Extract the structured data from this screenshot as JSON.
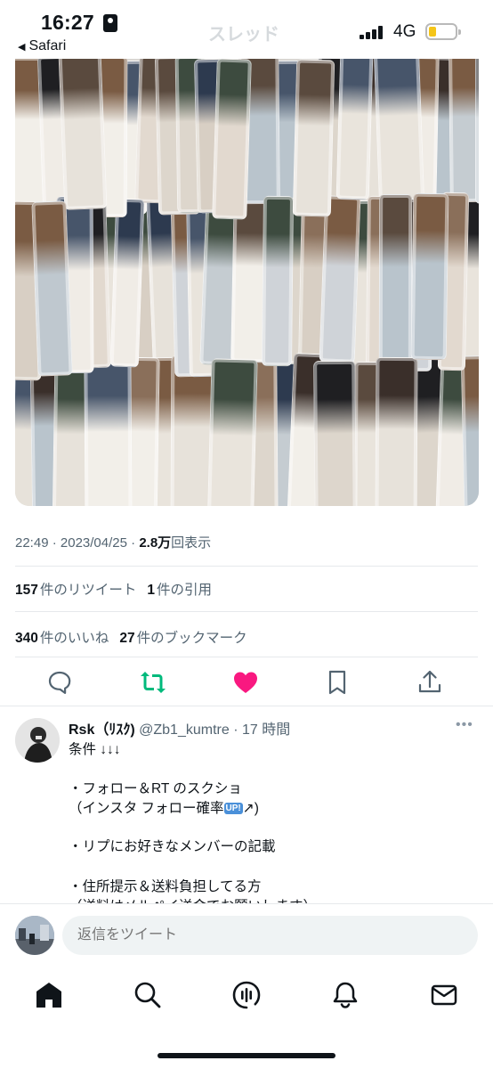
{
  "status_bar": {
    "time": "16:27",
    "back_app": "Safari",
    "faded_title": "スレッド",
    "network": "4G",
    "battery_color": "#f5c518"
  },
  "photo": {
    "icon": "photo-collage"
  },
  "tweet_meta": {
    "time": "22:49",
    "sep1": " · ",
    "date": "2023/04/25",
    "sep2": " · ",
    "views": "2.8万",
    "views_label": "回表示"
  },
  "stats": {
    "retweets_count": "157",
    "retweets_label": "件のリツイート",
    "quotes_count": "1",
    "quotes_label": "件の引用",
    "likes_count": "340",
    "likes_label": "件のいいね",
    "bookmarks_count": "27",
    "bookmarks_label": "件のブックマーク"
  },
  "actions": {
    "reply_icon": "reply-icon",
    "retweet_icon": "retweet-icon",
    "retweet_color": "#00ba7c",
    "like_icon": "like-icon",
    "like_color": "#f91880",
    "bookmark_icon": "bookmark-icon",
    "share_icon": "share-icon"
  },
  "reply": {
    "name": "Rsk（ﾘｽｸ)",
    "handle": "@Zb1_kumtre",
    "time": "· 17 時間",
    "more": "•••",
    "lines": [
      "条件 ↓↓↓",
      "・フォロー＆RT のスクショ",
      "（インスタ フォロー確率",
      "・リプにお好きなメンバーの記載",
      "・住所提示＆送料負担してる方",
      "（送料はメルペイ送金でお願いします）"
    ],
    "up_badge": "UP!",
    "line2_suffix": "↗)"
  },
  "composer": {
    "placeholder": "返信をツイート"
  },
  "tabbar": {
    "home": "home-icon",
    "search": "search-icon",
    "spaces": "spaces-icon",
    "notifications": "bell-icon",
    "messages": "mail-icon"
  }
}
